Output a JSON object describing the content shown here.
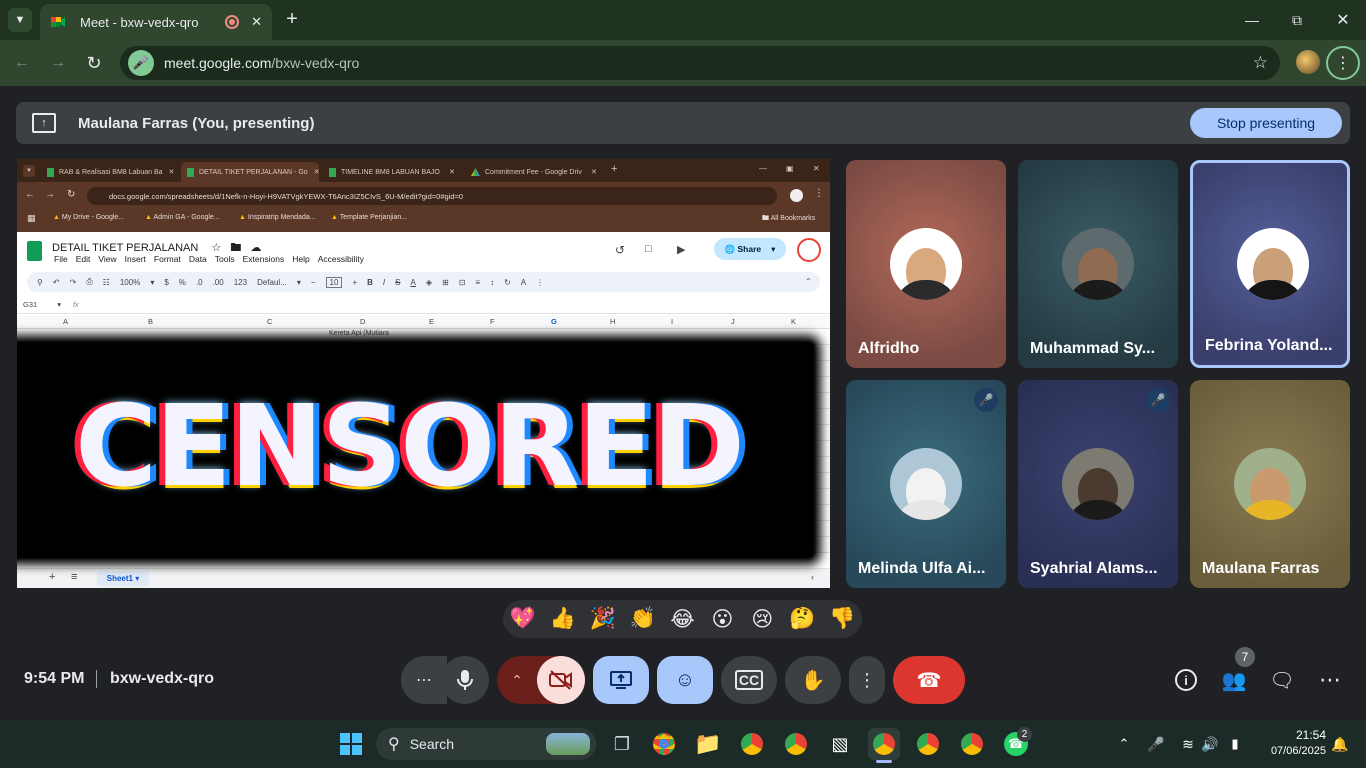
{
  "browser": {
    "tab_title": "Meet - bxw-vedx-qro",
    "url_domain": "meet.google.com",
    "url_path": "/bxw-vedx-qro"
  },
  "presenting": {
    "text": "Maulana Farras (You, presenting)",
    "stop_label": "Stop presenting"
  },
  "shared_screen": {
    "tabs": [
      "RAB & Realisasi BM8 Labuan Ba",
      "DETAIL TIKET PERJALANAN - Go",
      "TIMELINE BM8 LABUAN BAJO",
      "Commitment Fee - Google Driv"
    ],
    "url": "docs.google.com/spreadsheets/d/1Nefk-n-Hoyi-H9VATVgkYEWX-T6Anc3IZ5CIvS_6U-M/edit?gid=0#gid=0",
    "bookmarks": [
      "My Drive - Google...",
      "Admin GA - Google...",
      "Inspiratrip Mendada...",
      "Template Perjanjian...",
      "All Bookmarks"
    ],
    "doc_title": "DETAIL TIKET PERJALANAN",
    "menus": [
      "File",
      "Edit",
      "View",
      "Insert",
      "Format",
      "Data",
      "Tools",
      "Extensions",
      "Help",
      "Accessibility"
    ],
    "share_label": "Share",
    "zoom": "100%",
    "font": "Defaul...",
    "font_size": "10",
    "cell_ref": "G31",
    "columns": [
      "A",
      "B",
      "C",
      "D",
      "E",
      "F",
      "G",
      "H",
      "I",
      "J",
      "K"
    ],
    "cell_d_text": "Kereta Api (Mutiara",
    "sheet_tab": "Sheet1",
    "censor_text": "CENSORED"
  },
  "participants": [
    {
      "name": "Alfridho",
      "muted": false
    },
    {
      "name": "Muhammad Sy...",
      "muted": false
    },
    {
      "name": "Febrina Yoland...",
      "muted": false
    },
    {
      "name": "Melinda Ulfa Ai...",
      "muted": true
    },
    {
      "name": "Syahrial Alams...",
      "muted": true
    },
    {
      "name": "Maulana Farras",
      "muted": false
    }
  ],
  "reactions": [
    "💖",
    "👍",
    "🎉",
    "👏",
    "😂",
    "😮",
    "😢",
    "🤔",
    "👎"
  ],
  "meeting": {
    "time": "9:54 PM",
    "code": "bxw-vedx-qro",
    "people_count": "7"
  },
  "taskbar": {
    "search_label": "Search",
    "whatsapp_badge": "2",
    "time": "21:54",
    "date": "07/06/2025"
  }
}
